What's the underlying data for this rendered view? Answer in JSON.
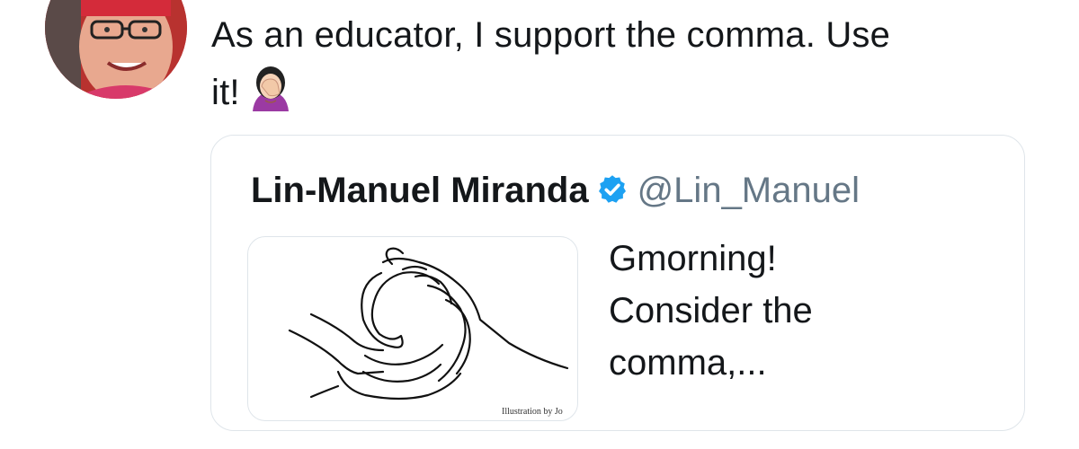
{
  "tweet": {
    "text_line1": "As an educator, I support the comma. Use",
    "text_line2": "it!",
    "emoji": "face-palm-woman-emoji",
    "avatar_icon": "user-avatar-photo"
  },
  "quoted_tweet": {
    "name": "Lin-Manuel Miranda",
    "verified_icon": "verified-badge-icon",
    "handle": "@Lin_Manuel",
    "media_icon": "hands-holding-comma-illustration",
    "media_credit": "Illustration by Jo",
    "body_line1": "Gmorning!",
    "body_line2": "Consider the",
    "body_line3": "comma,..."
  },
  "colors": {
    "text": "#14171a",
    "secondary_text": "#657786",
    "border": "#dfe5ea",
    "verified": "#1da1f2"
  }
}
